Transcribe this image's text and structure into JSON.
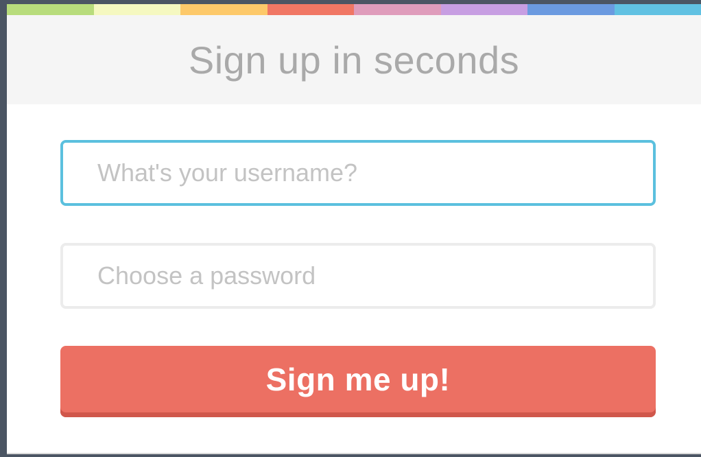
{
  "strip_colors": [
    "#b8dc7c",
    "#f5f8c0",
    "#fdc96a",
    "#f07764",
    "#df9cbb",
    "#c79ee2",
    "#6b9ae0",
    "#61c1e2"
  ],
  "header": {
    "title": "Sign up in seconds"
  },
  "form": {
    "username_placeholder": "What's your username?",
    "username_value": "",
    "password_placeholder": "Choose a password",
    "password_value": "",
    "submit_label": "Sign me up!"
  },
  "colors": {
    "accent_border": "#5bc0de",
    "submit_bg": "#ec7063"
  }
}
